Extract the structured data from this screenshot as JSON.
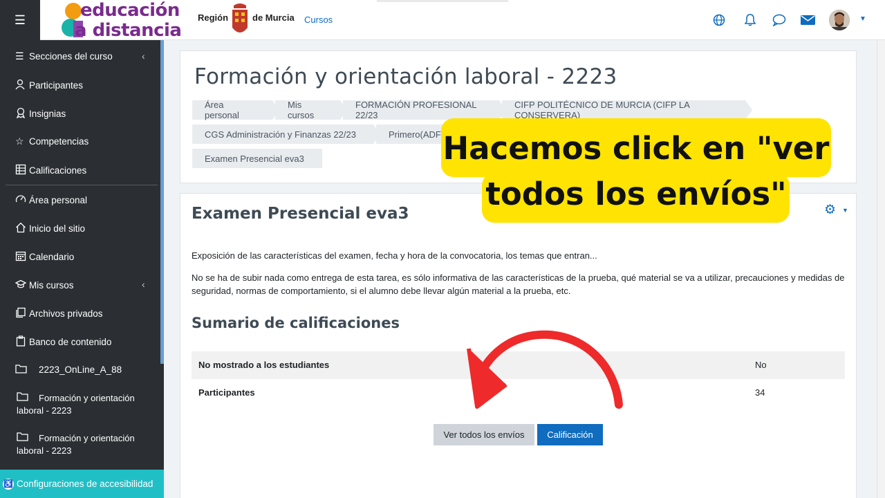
{
  "navbar": {
    "logo_line1": "educación",
    "logo_line2": "a distancia",
    "region_label": "Región",
    "murcia_label": "de Murcia",
    "cursos_link": "Cursos",
    "icons": [
      "menu-icon",
      "globe-icon",
      "bell-icon",
      "chat-icon",
      "envelope-icon",
      "avatar"
    ]
  },
  "sidebar": {
    "items": [
      {
        "label": "Secciones del curso",
        "icon": "list-icon",
        "chevron": true
      },
      {
        "label": "Participantes",
        "icon": "users-icon"
      },
      {
        "label": "Insignias",
        "icon": "badge-icon"
      },
      {
        "label": "Competencias",
        "icon": "star-icon"
      },
      {
        "label": "Calificaciones",
        "icon": "grades-icon"
      },
      {
        "label": "Área personal",
        "icon": "dashboard-icon"
      },
      {
        "label": "Inicio del sitio",
        "icon": "home-icon"
      },
      {
        "label": "Calendario",
        "icon": "calendar-icon"
      },
      {
        "label": "Mis cursos",
        "icon": "graduation-icon",
        "chevron": true
      },
      {
        "label": "Archivos privados",
        "icon": "files-icon"
      },
      {
        "label": "Banco de contenido",
        "icon": "clipboard-icon"
      }
    ],
    "courses": [
      {
        "label": "2223_OnLine_A_88"
      },
      {
        "label_l1": "Formación y orientación",
        "label_l2": "laboral - 2223"
      },
      {
        "label_l1": "Formación y orientación",
        "label_l2": "laboral - 2223"
      }
    ],
    "accessibility": "Configuraciones de accesibilidad"
  },
  "header": {
    "title": "Formación y orientación laboral - 2223",
    "breadcrumbs": [
      "Área personal",
      "Mis cursos",
      "FORMACIÓN PROFESIONAL 22/23",
      "CIFP POLITÉCNICO DE MURCIA (CIFP LA CONSERVERA)",
      "CGS Administración y Finanzas 22/23",
      "Primero(ADF",
      "Examen Presencial eva3"
    ]
  },
  "content": {
    "title": "Examen Presencial eva3",
    "para1": "Exposición de las características del examen, fecha y hora de la convocatoria, los temas que entran...",
    "para2": "No se ha de subir nada como entrega de esta tarea, es sólo informativa de las características de la prueba, qué material se va a utilizar, precauciones y medidas de seguridad, normas de comportamiento, si el alumno debe llevar algún material a la prueba, etc.",
    "summary_title": "Sumario de calificaciones",
    "table": [
      {
        "label": "No mostrado a los estudiantes",
        "value": "No"
      },
      {
        "label": "Participantes",
        "value": "34"
      }
    ],
    "btn_view_all": "Ver todos los envíos",
    "btn_grade": "Calificación"
  },
  "overlay": {
    "line1": "Hacemos click en \"ver",
    "line2": "todos los envíos\"",
    "color": "#ffe302",
    "arrow_color": "#ee2a2a"
  }
}
